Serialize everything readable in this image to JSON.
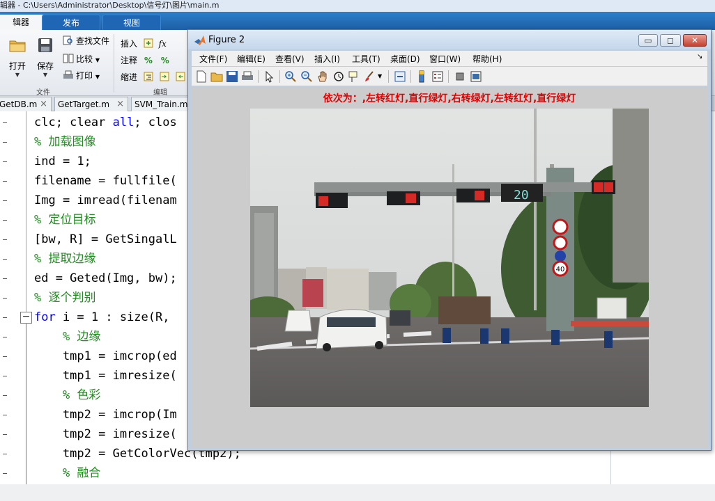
{
  "window": {
    "title": "辑器 - C:\\Users\\Administrator\\Desktop\\信号灯\\图片\\main.m"
  },
  "ribbon_tabs": [
    {
      "label": "辑器"
    },
    {
      "label": "发布"
    },
    {
      "label": "视图"
    }
  ],
  "ribbon": {
    "open_label": "打开",
    "save_label": "保存",
    "find_files_label": "查找文件",
    "compare_label": "比较",
    "print_label": "打印",
    "insert_label": "插入",
    "comment_label": "注释",
    "indent_label": "缩进",
    "fx_label": "fx",
    "group_file": "文件",
    "group_edit": "编辑"
  },
  "file_tabs": [
    {
      "label": "GetDB.m"
    },
    {
      "label": "GetTarget.m"
    },
    {
      "label": "SVM_Train.m"
    }
  ],
  "code_lines": [
    {
      "pre": "clc; clear ",
      "kw": "all",
      "post": "; clos"
    },
    {
      "comment": "% 加载图像"
    },
    {
      "text": "ind = 1;"
    },
    {
      "text": "filename = fullfile("
    },
    {
      "text": "Img = imread(filenam"
    },
    {
      "comment": "% 定位目标"
    },
    {
      "text": "[bw, R] = GetSingalL"
    },
    {
      "comment": "% 提取边缘"
    },
    {
      "text": "ed = Geted(Img, bw);"
    },
    {
      "comment": "% 逐个判别"
    },
    {
      "kw": "for",
      "post": " i = 1 : size(R,"
    },
    {
      "comment": "    % 边缘"
    },
    {
      "text": "    tmp1 = imcrop(ed"
    },
    {
      "text": "    tmp1 = imresize("
    },
    {
      "comment": "    % 色彩"
    },
    {
      "text": "    tmp2 = imcrop(Im"
    },
    {
      "text": "    tmp2 = imresize("
    },
    {
      "text": "    tmp2 = GetColorVec(tmp2);"
    },
    {
      "comment": "    % 融合"
    }
  ],
  "figure": {
    "title": "Figure 2",
    "menu": [
      "文件(F)",
      "编辑(E)",
      "查看(V)",
      "插入(I)",
      "工具(T)",
      "桌面(D)",
      "窗口(W)",
      "帮助(H)"
    ],
    "caption": "依次为：,左转红灯,直行绿灯,右转绿灯,左转红灯,直行绿灯",
    "countdown": "20",
    "speed_sign": "40"
  },
  "colors": {
    "caption": "#e00000",
    "keyword": "#0000ff",
    "comment": "#228b22",
    "string": "#a020f0"
  }
}
